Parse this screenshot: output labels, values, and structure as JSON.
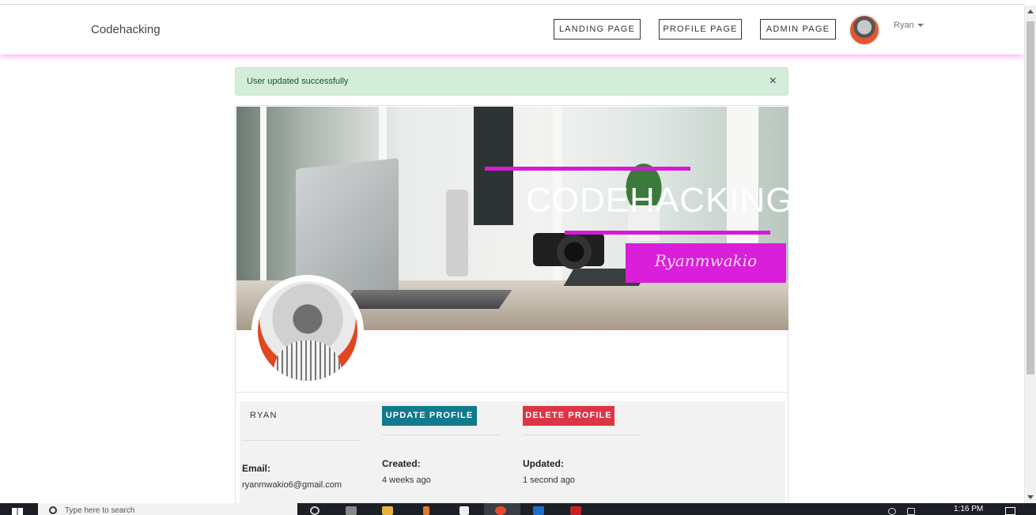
{
  "navbar": {
    "brand": "Codehacking",
    "links": [
      "LANDING PAGE",
      "PROFILE PAGE",
      "ADMIN PAGE"
    ],
    "user_name": "Ryan"
  },
  "alert": {
    "message": "User updated successfully",
    "close_symbol": "×"
  },
  "banner": {
    "title": "CODEHACKING",
    "signature": "Ryanmwakio"
  },
  "profile": {
    "name": "RYAN",
    "update_button": "UPDATE PROFILE",
    "delete_button": "DELETE PROFILE",
    "email_label": "Email:",
    "email_value": "ryanmwakio6@gmail.com",
    "created_label": "Created:",
    "created_value": "4 weeks ago",
    "updated_label": "Updated:",
    "updated_value": "1 second ago"
  },
  "taskbar": {
    "search_placeholder": "Type here to search",
    "time": "1:16 PM"
  },
  "colors": {
    "accent_magenta": "#d61ad6",
    "update_button": "#117a8b",
    "delete_button": "#dc3545",
    "alert_bg": "#d4edda",
    "alert_text": "#155724"
  },
  "icons": {
    "close": "close-icon",
    "caret": "chevron-down-icon",
    "search": "search-icon",
    "windows": "windows-icon"
  }
}
